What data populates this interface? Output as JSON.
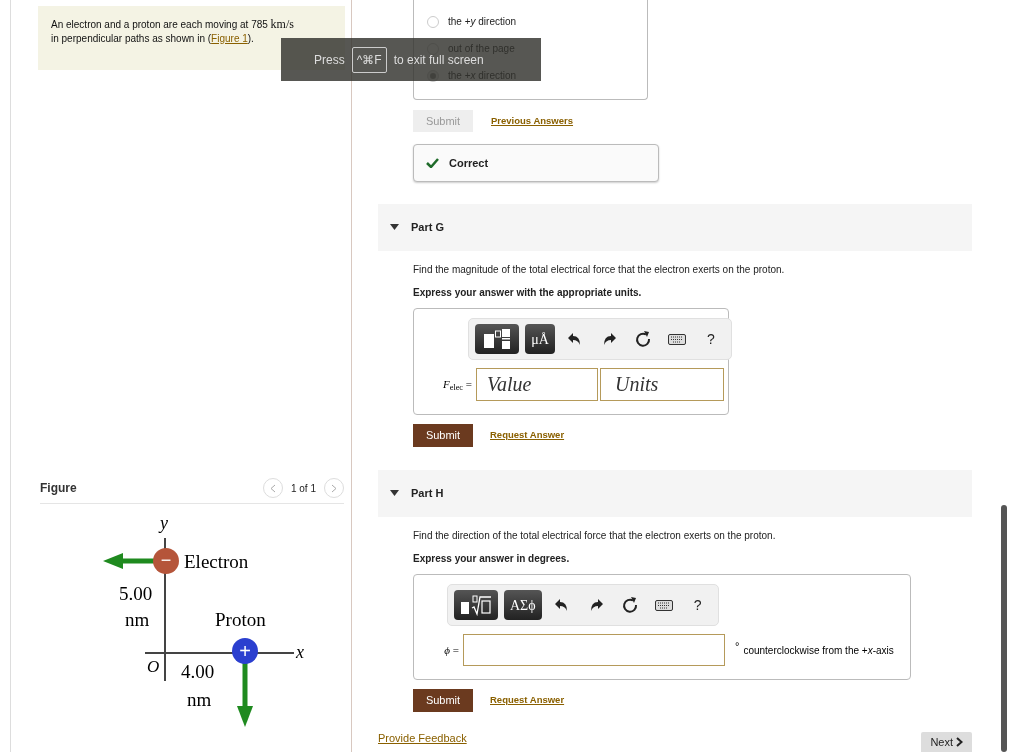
{
  "problem": {
    "text_before": "An electron and a proton are each moving at 785",
    "unit": "km/s",
    "text_after": "in perpendicular paths as shown in (",
    "link": "Figure 1",
    "text_end": ")."
  },
  "figure": {
    "title": "Figure",
    "pager": "1 of 1",
    "labels": {
      "y_axis": "y",
      "x_axis": "x",
      "origin": "O",
      "electron": "Electron",
      "proton": "Proton",
      "electron_sign": "−",
      "proton_sign": "+",
      "y_distance": "5.00",
      "y_unit": "nm",
      "x_distance": "4.00",
      "x_unit": "nm"
    }
  },
  "fullscreen_notice": {
    "before": "Press",
    "key": "^⌘F",
    "after": "to exit full screen"
  },
  "previous_part": {
    "options": [
      {
        "label": "the +*y* direction",
        "selected": false
      },
      {
        "label": "out of the page",
        "selected": false
      },
      {
        "label": "the +*x* direction",
        "selected": true
      }
    ],
    "submit": "Submit",
    "submit_disabled": true,
    "previous_answers": "Previous Answers",
    "result": "Correct"
  },
  "parts": [
    {
      "label": "Part G",
      "expanded": true,
      "question": "Find the magnitude of the total electrical force that the electron exerts on the proton.",
      "instruction": "Express your answer with the appropriate units.",
      "toolbar": [
        {
          "kind": "template_fraction"
        },
        {
          "kind": "symbols",
          "label": "μÅ"
        },
        {
          "kind": "undo"
        },
        {
          "kind": "redo"
        },
        {
          "kind": "reset"
        },
        {
          "kind": "keyboard"
        },
        {
          "kind": "help",
          "label": "?"
        }
      ],
      "answer": {
        "kind": "value_units",
        "label": "*F*$_{elec}$ =",
        "value_placeholder": "Value",
        "units_placeholder": "Units"
      },
      "submit": "Submit",
      "request": "Request Answer"
    },
    {
      "label": "Part H",
      "expanded": true,
      "question": "Find the direction of the total electrical force that the electron exerts on the proton.",
      "instruction": "Express your answer in degrees.",
      "toolbar": [
        {
          "kind": "template_root"
        },
        {
          "kind": "symbols",
          "label": "ΑΣϕ"
        },
        {
          "kind": "undo"
        },
        {
          "kind": "redo"
        },
        {
          "kind": "reset"
        },
        {
          "kind": "keyboard"
        },
        {
          "kind": "help",
          "label": "?"
        }
      ],
      "answer": {
        "kind": "single",
        "label": "*ϕ* =",
        "suffix": "°",
        "unit_text": "counterclockwise from the +*x*-axis"
      },
      "submit": "Submit",
      "request": "Request Answer"
    }
  ],
  "footer": {
    "feedback": "Provide Feedback",
    "next": "Next"
  }
}
